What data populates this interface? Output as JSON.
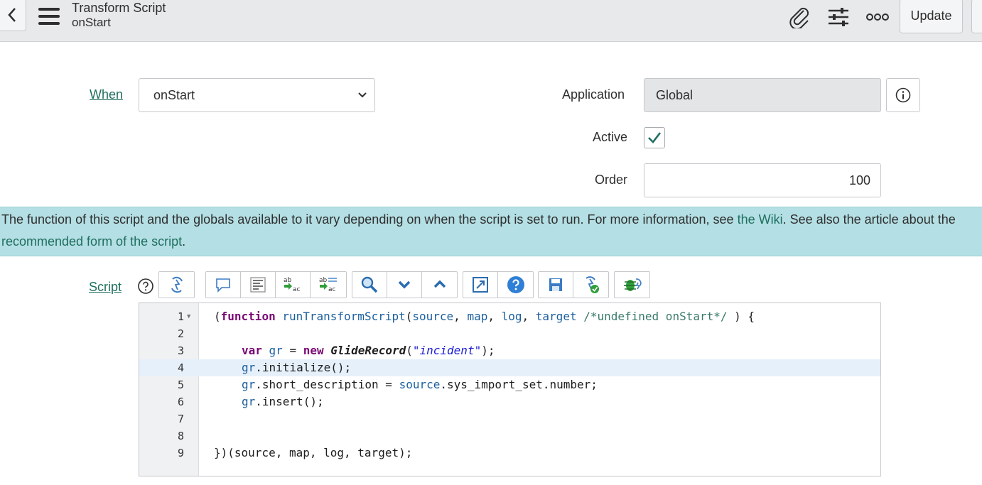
{
  "header": {
    "title": "Transform Script",
    "subtitle": "onStart",
    "update_label": "Update",
    "icons": [
      "back-icon",
      "hamburger-menu-icon",
      "paperclip-icon",
      "sliders-icon",
      "more-options-icon"
    ]
  },
  "form": {
    "when_label": "When",
    "when_value": "onStart",
    "application_label": "Application",
    "application_value": "Global",
    "active_label": "Active",
    "active_checked": true,
    "order_label": "Order",
    "order_value": "100"
  },
  "banner": {
    "text_part1": "The function of this script and the globals available to it vary depending on when the script is set to run. For more information, see ",
    "wiki_link": "the Wiki",
    "text_part2": ". See also the article about the ",
    "article_link": "recommended form of the script",
    "text_part3": "."
  },
  "script": {
    "label": "Script",
    "toolbar_icons": [
      [
        "toggle-syntax-icon"
      ],
      [
        "comment-icon",
        "format-code-icon",
        "replace-icon",
        "replace-all-icon"
      ],
      [
        "search-icon",
        "next-icon",
        "previous-icon"
      ],
      [
        "fullscreen-icon",
        "help-icon"
      ],
      [
        "save-icon",
        "script-check-icon"
      ],
      [
        "debug-icon"
      ]
    ],
    "active_line": 4,
    "lines": [
      {
        "n": "1"
      },
      {
        "n": "2"
      },
      {
        "n": "3"
      },
      {
        "n": "4"
      },
      {
        "n": "5"
      },
      {
        "n": "6"
      },
      {
        "n": "7"
      },
      {
        "n": "8"
      },
      {
        "n": "9"
      }
    ],
    "code": {
      "l1_open": "(",
      "l1_kw": "function",
      "l1_fn": "runTransformScript",
      "l1_p1": "(",
      "l1_src": "source",
      "l1_c1": ", ",
      "l1_map": "map",
      "l1_c2": ", ",
      "l1_log": "log",
      "l1_c3": ", ",
      "l1_target": "target",
      "l1_comment": " /*undefined onStart*/",
      "l1_end": " ) {",
      "l3_kw1": "var",
      "l3_gr": "gr",
      "l3_eq": " = ",
      "l3_new": "new",
      "l3_cls": "GlideRecord",
      "l3_p": "(",
      "l3_str": "\"incident\"",
      "l3_end": ");",
      "l4_gr": "gr",
      "l4_rest": ".initialize();",
      "l5_gr": "gr",
      "l5_mid": ".short_description = ",
      "l5_src": "source",
      "l5_rest": ".sys_import_set.number;",
      "l6_gr": "gr",
      "l6_rest": ".insert();",
      "l9": "})(source, map, log, target);"
    }
  }
}
